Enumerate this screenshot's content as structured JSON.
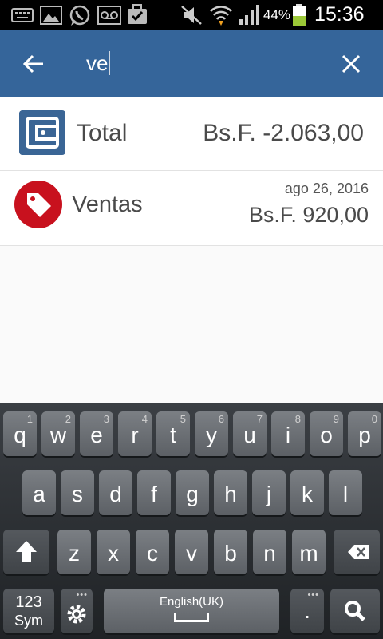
{
  "status_bar": {
    "battery_percent": "44%",
    "time": "15:36",
    "icons": [
      "keyboard-icon",
      "gallery-icon",
      "whatsapp-icon",
      "voicemail-icon",
      "briefcase-icon",
      "muted-icon",
      "wifi-icon",
      "signal-icon",
      "battery-icon"
    ]
  },
  "app_bar": {
    "search_query": "ve",
    "back_icon": "back-arrow-icon",
    "close_icon": "close-icon",
    "color": "#35659a"
  },
  "results": [
    {
      "icon": "wallet-icon",
      "label": "Total",
      "amount": "Bs.F. -2.063,00"
    },
    {
      "icon": "tag-icon",
      "label": "Ventas",
      "date": "ago 26, 2016",
      "amount": "Bs.F. 920,00"
    }
  ],
  "keyboard": {
    "row1": [
      {
        "k": "q",
        "h": "1"
      },
      {
        "k": "w",
        "h": "2"
      },
      {
        "k": "e",
        "h": "3"
      },
      {
        "k": "r",
        "h": "4"
      },
      {
        "k": "t",
        "h": "5"
      },
      {
        "k": "y",
        "h": "6"
      },
      {
        "k": "u",
        "h": "7"
      },
      {
        "k": "i",
        "h": "8"
      },
      {
        "k": "o",
        "h": "9"
      },
      {
        "k": "p",
        "h": "0"
      }
    ],
    "row2": [
      "a",
      "s",
      "d",
      "f",
      "g",
      "h",
      "j",
      "k",
      "l"
    ],
    "row3": [
      "z",
      "x",
      "c",
      "v",
      "b",
      "n",
      "m"
    ],
    "sym_line1": "123",
    "sym_line2": "Sym",
    "space_label": "English(UK)",
    "period": "."
  }
}
